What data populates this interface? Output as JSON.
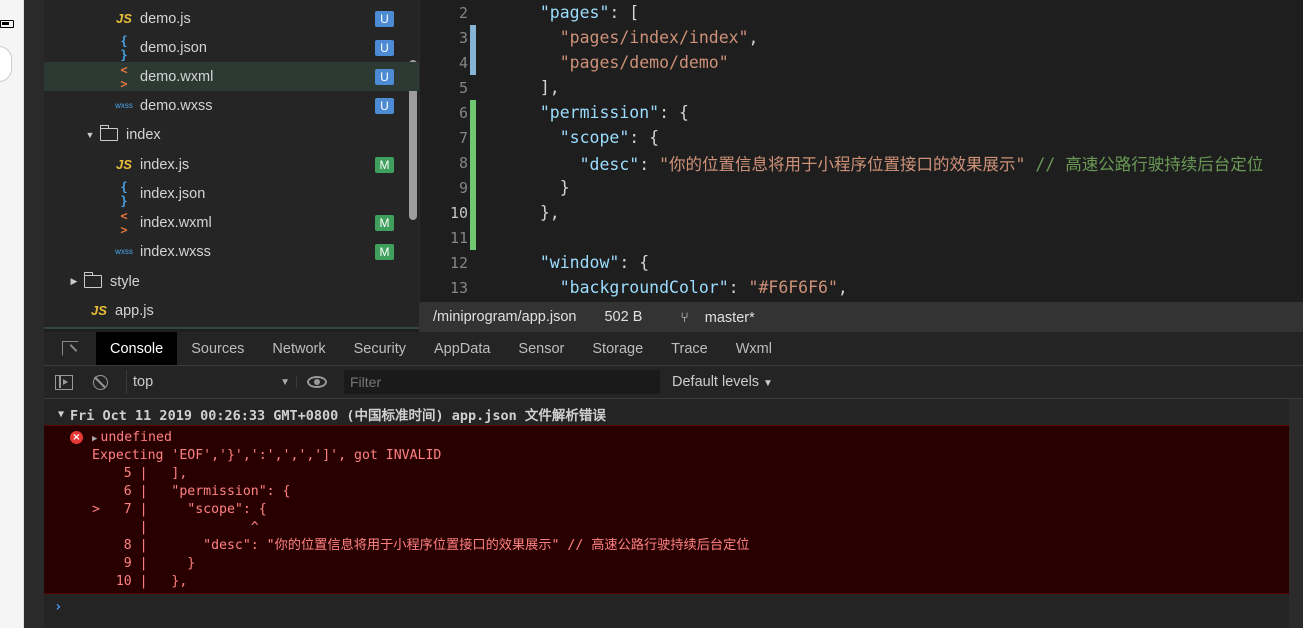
{
  "file_tree": {
    "items": [
      {
        "label": "demo.js",
        "icon": "js",
        "badge": "U"
      },
      {
        "label": "demo.json",
        "icon": "json",
        "badge": "U"
      },
      {
        "label": "demo.wxml",
        "icon": "wxml",
        "badge": "U"
      },
      {
        "label": "demo.wxss",
        "icon": "wxss",
        "badge": "U"
      },
      {
        "label": "index",
        "icon": "folder"
      },
      {
        "label": "index.js",
        "icon": "js",
        "badge": "M"
      },
      {
        "label": "index.json",
        "icon": "json"
      },
      {
        "label": "index.wxml",
        "icon": "wxml",
        "badge": "M"
      },
      {
        "label": "index.wxss",
        "icon": "wxss",
        "badge": "M"
      },
      {
        "label": "style",
        "icon": "folder"
      },
      {
        "label": "app.js",
        "icon": "js"
      }
    ],
    "icon_glyphs": {
      "js": "JS",
      "json": "{ }",
      "wxml": "< >",
      "wxss": "wxss"
    }
  },
  "editor": {
    "lines": [
      {
        "n": "2",
        "parts": [
          [
            "p",
            "  "
          ],
          [
            "key",
            "\"pages\""
          ],
          [
            "p",
            ": ["
          ]
        ]
      },
      {
        "n": "3",
        "parts": [
          [
            "p",
            "    "
          ],
          [
            "str",
            "\"pages/index/index\""
          ],
          [
            "p",
            ","
          ]
        ]
      },
      {
        "n": "4",
        "parts": [
          [
            "p",
            "    "
          ],
          [
            "str",
            "\"pages/demo/demo\""
          ]
        ]
      },
      {
        "n": "5",
        "parts": [
          [
            "p",
            "  ],"
          ]
        ]
      },
      {
        "n": "6",
        "parts": [
          [
            "p",
            "  "
          ],
          [
            "key",
            "\"permission\""
          ],
          [
            "p",
            ": {"
          ]
        ]
      },
      {
        "n": "7",
        "parts": [
          [
            "p",
            "    "
          ],
          [
            "key",
            "\"scope\""
          ],
          [
            "p",
            ": {"
          ]
        ]
      },
      {
        "n": "8",
        "parts": [
          [
            "p",
            "      "
          ],
          [
            "key",
            "\"desc\""
          ],
          [
            "p",
            ": "
          ],
          [
            "str",
            "\"你的位置信息将用于小程序位置接口的效果展示\""
          ],
          [
            "p",
            " "
          ],
          [
            "cmt",
            "// 高速公路行驶持续后台定位"
          ]
        ]
      },
      {
        "n": "9",
        "parts": [
          [
            "p",
            "    }"
          ]
        ]
      },
      {
        "n": "10",
        "parts": [
          [
            "p",
            "  },"
          ]
        ]
      },
      {
        "n": "11",
        "parts": [
          [
            "p",
            ""
          ]
        ]
      },
      {
        "n": "12",
        "parts": [
          [
            "p",
            "  "
          ],
          [
            "key",
            "\"window\""
          ],
          [
            "p",
            ": {"
          ]
        ]
      },
      {
        "n": "13",
        "parts": [
          [
            "p",
            "    "
          ],
          [
            "key",
            "\"backgroundColor\""
          ],
          [
            "p",
            ": "
          ],
          [
            "str",
            "\"#F6F6F6\""
          ],
          [
            "p",
            ","
          ]
        ]
      }
    ]
  },
  "statusbar": {
    "path": "/miniprogram/app.json",
    "size": "502 B",
    "branch": "master*"
  },
  "devtools": {
    "tabs": [
      "Console",
      "Sources",
      "Network",
      "Security",
      "AppData",
      "Sensor",
      "Storage",
      "Trace",
      "Wxml"
    ],
    "active_tab": "Console",
    "context": "top",
    "filter_placeholder": "Filter",
    "levels": "Default levels"
  },
  "console": {
    "group_header": "Fri Oct 11 2019 00:26:33 GMT+0800 (中国标准时间)  app.json 文件解析错误",
    "error_lines": [
      "undefined",
      "Expecting 'EOF','}',':',',',']', got INVALID",
      "    5 |   ],",
      "    6 |   \"permission\": {",
      ">   7 |     \"scope\": {",
      "      |             ^",
      "    8 |       \"desc\": \"你的位置信息将用于小程序位置接口的效果展示\" // 高速公路行驶持续后台定位",
      "    9 |     }",
      "   10 |   },"
    ],
    "prompt": "›"
  }
}
